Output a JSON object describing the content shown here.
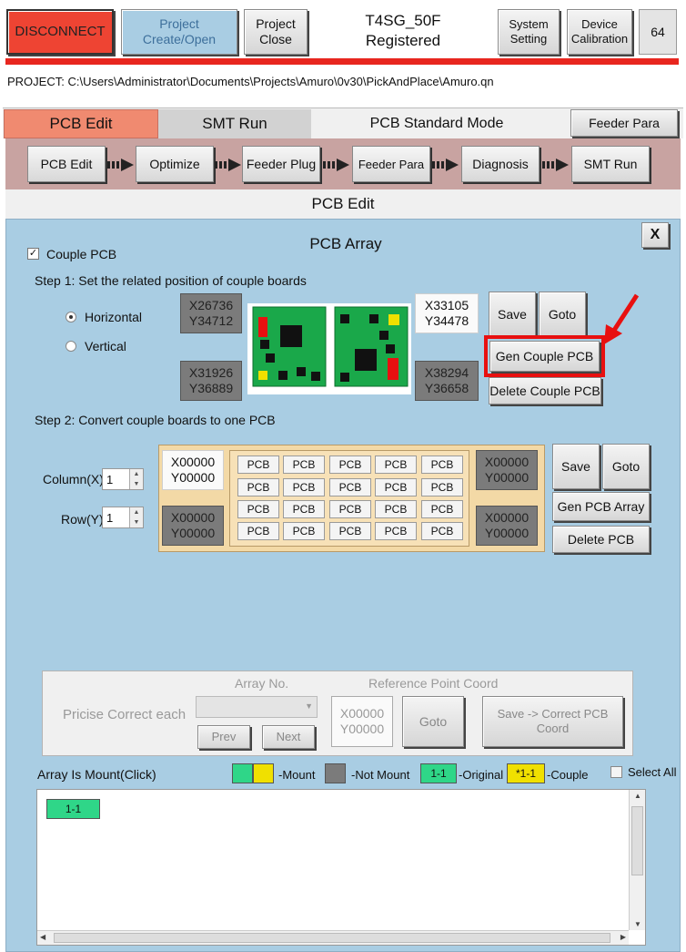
{
  "header": {
    "disconnect_label": "DISCONNECT",
    "project_create_label": "Project Create/Open",
    "project_close_label": "Project Close",
    "machine_title": "T4SG_50F",
    "machine_status": "Registered",
    "system_setting_label": "System Setting",
    "device_calibration_label": "Device Calibration",
    "counter": "64"
  },
  "project_path": "PROJECT: C:\\Users\\Administrator\\Documents\\Projects\\Amuro\\0v30\\PickAndPlace\\Amuro.qn",
  "tabs": {
    "pcb_edit": "PCB Edit",
    "smt_run": "SMT Run",
    "mode_label": "PCB Standard Mode",
    "feeder_para": "Feeder Para"
  },
  "workflow": {
    "steps": [
      "PCB Edit",
      "Optimize",
      "Feeder Plug",
      "Feeder Para",
      "Diagnosis",
      "SMT Run"
    ]
  },
  "section_title": "PCB Edit",
  "pcb_array": {
    "title": "PCB Array",
    "close_label": "X",
    "couple_checkbox_label": "Couple PCB",
    "couple_checked": true,
    "step1_label": "Step 1: Set the related position of couple boards",
    "orientation_horizontal": "Horizontal",
    "orientation_vertical": "Vertical",
    "selected_orientation": "Horizontal",
    "coord_top_left": {
      "x": "X26736",
      "y": "Y34712"
    },
    "coord_bottom_left": {
      "x": "X31926",
      "y": "Y36889"
    },
    "coord_top_right": {
      "x": "X33105",
      "y": "Y34478"
    },
    "coord_bottom_right": {
      "x": "X38294",
      "y": "Y36658"
    },
    "save_label": "Save",
    "goto_label": "Goto",
    "gen_couple_label": "Gen Couple PCB",
    "delete_couple_label": "Delete Couple PCB",
    "highlight_color": "#e81010",
    "step2_label": "Step 2: Convert couple boards to one PCB",
    "column_label": "Column(X)",
    "column_value": "1",
    "row_label": "Row(Y)",
    "row_value": "1",
    "grid_coord_tl": {
      "x": "X00000",
      "y": "Y00000"
    },
    "grid_coord_bl": {
      "x": "X00000",
      "y": "Y00000"
    },
    "grid_coord_tr": {
      "x": "X00000",
      "y": "Y00000"
    },
    "grid_coord_br": {
      "x": "X00000",
      "y": "Y00000"
    },
    "grid_cells": [
      [
        "PCB",
        "PCB",
        "PCB",
        "PCB",
        "PCB"
      ],
      [
        "PCB",
        "PCB",
        "PCB",
        "PCB",
        "PCB"
      ],
      [
        "PCB",
        "PCB",
        "PCB",
        "PCB",
        "PCB"
      ],
      [
        "PCB",
        "PCB",
        "PCB",
        "PCB",
        "PCB"
      ]
    ],
    "grid_save_label": "Save",
    "grid_goto_label": "Goto",
    "gen_array_label": "Gen PCB Array",
    "delete_pcb_label": "Delete PCB"
  },
  "precise": {
    "label": "Pricise Correct each",
    "array_no_label": "Array No.",
    "prev_label": "Prev",
    "next_label": "Next",
    "ref_point_label": "Reference Point Coord",
    "ref_x": "X00000",
    "ref_y": "Y00000",
    "goto_label": "Goto",
    "save_correct_label": "Save -> Correct PCB Coord"
  },
  "mount": {
    "title": "Array Is Mount(Click)",
    "legend_mount": "-Mount",
    "legend_not_mount": "-Not Mount",
    "legend_original_tag": "1-1",
    "legend_original": "-Original",
    "legend_couple_tag": "*1-1",
    "legend_couple": "-Couple",
    "select_all_label": "Select All",
    "items": [
      "1-1"
    ]
  },
  "colors": {
    "disconnect": "#ee4433",
    "accent_bar": "#e8261f",
    "panel_bg": "#a9cde3",
    "mount_green": "#2fd688",
    "mount_yellow": "#f0e000",
    "not_mount_gray": "#7b7b7b"
  }
}
